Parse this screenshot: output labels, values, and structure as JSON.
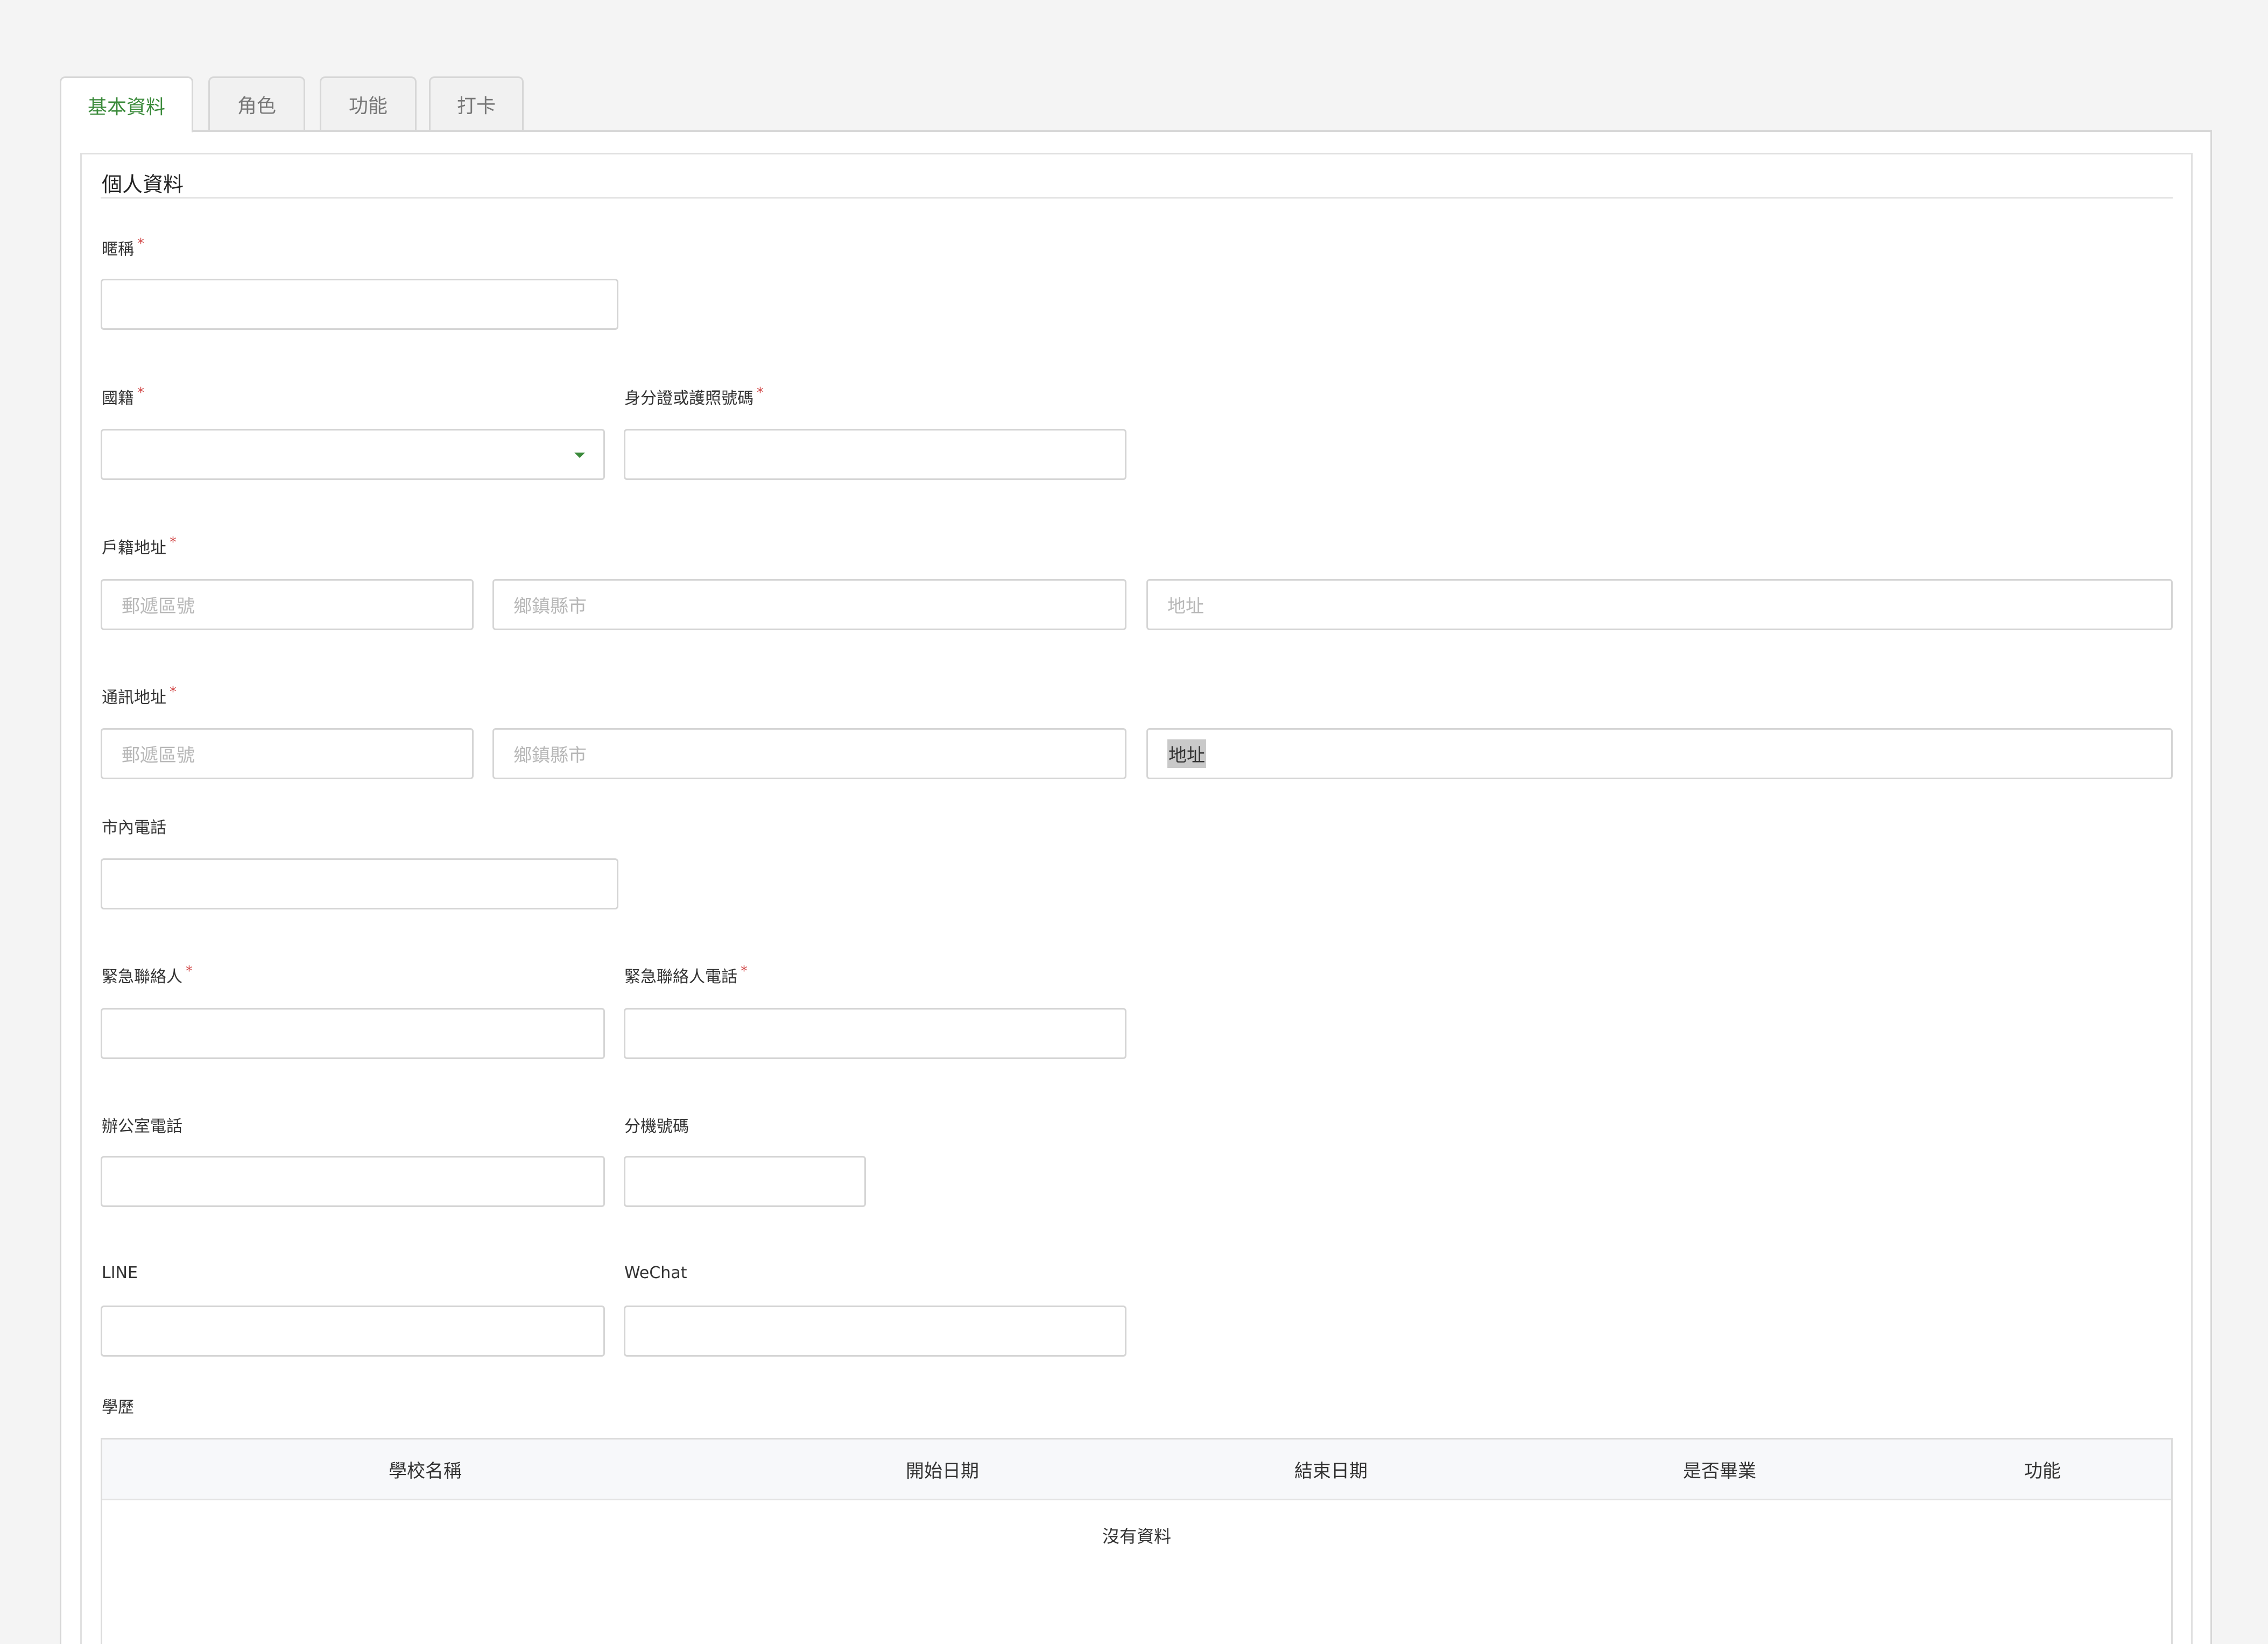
{
  "tabs": [
    {
      "label": "基本資料",
      "active": true
    },
    {
      "label": "角色",
      "active": false
    },
    {
      "label": "功能",
      "active": false
    },
    {
      "label": "打卡",
      "active": false
    }
  ],
  "section": {
    "title": "個人資料"
  },
  "required_mark": "*",
  "fields": {
    "nickname": {
      "label": "暱稱",
      "value": ""
    },
    "nationality": {
      "label": "國籍",
      "value": ""
    },
    "id_number": {
      "label": "身分證或護照號碼",
      "value": ""
    },
    "registered_address": {
      "label": "戶籍地址",
      "postal_placeholder": "郵遞區號",
      "city_placeholder": "鄉鎮縣市",
      "address_placeholder": "地址"
    },
    "mailing_address": {
      "label": "通訊地址",
      "postal_placeholder": "郵遞區號",
      "city_placeholder": "鄉鎮縣市",
      "address_value": "地址"
    },
    "home_phone": {
      "label": "市內電話",
      "value": ""
    },
    "emergency_contact": {
      "label": "緊急聯絡人",
      "value": ""
    },
    "emergency_phone": {
      "label": "緊急聯絡人電話",
      "value": ""
    },
    "office_phone": {
      "label": "辦公室電話",
      "value": ""
    },
    "extension": {
      "label": "分機號碼",
      "value": ""
    },
    "line": {
      "label": "LINE",
      "value": ""
    },
    "wechat": {
      "label": "WeChat",
      "value": ""
    }
  },
  "education": {
    "label": "學歷",
    "columns": [
      "學校名稱",
      "開始日期",
      "結束日期",
      "是否畢業",
      "功能"
    ],
    "empty_text": "沒有資料"
  },
  "colors": {
    "accent": "#3a8a3a",
    "required": "#d24a4a",
    "background": "#f4f4f4",
    "border": "#d5d5d5"
  },
  "icons": {
    "nationality_dropdown": "caret-down-icon"
  }
}
